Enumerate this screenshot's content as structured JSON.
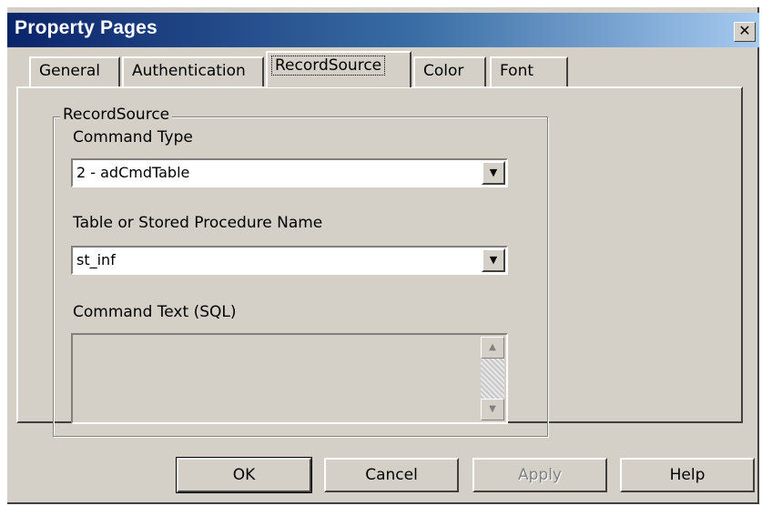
{
  "window": {
    "title": "Property Pages",
    "close_glyph": "✕"
  },
  "tabs": [
    {
      "label": "General",
      "active": false
    },
    {
      "label": "Authentication",
      "active": false
    },
    {
      "label": "RecordSource",
      "active": true
    },
    {
      "label": "Color",
      "active": false
    },
    {
      "label": "Font",
      "active": false
    }
  ],
  "recordsource": {
    "group_label": "RecordSource",
    "command_type_label": "Command Type",
    "command_type_value": "2 - adCmdTable",
    "table_label": "Table or Stored Procedure Name",
    "table_value": "st_inf",
    "command_text_label": "Command Text (SQL)",
    "command_text_value": ""
  },
  "buttons": {
    "ok": "OK",
    "cancel": "Cancel",
    "apply": "Apply",
    "help": "Help"
  },
  "icons": {
    "dropdown": "▼",
    "scroll_up": "▲",
    "scroll_down": "▼"
  }
}
